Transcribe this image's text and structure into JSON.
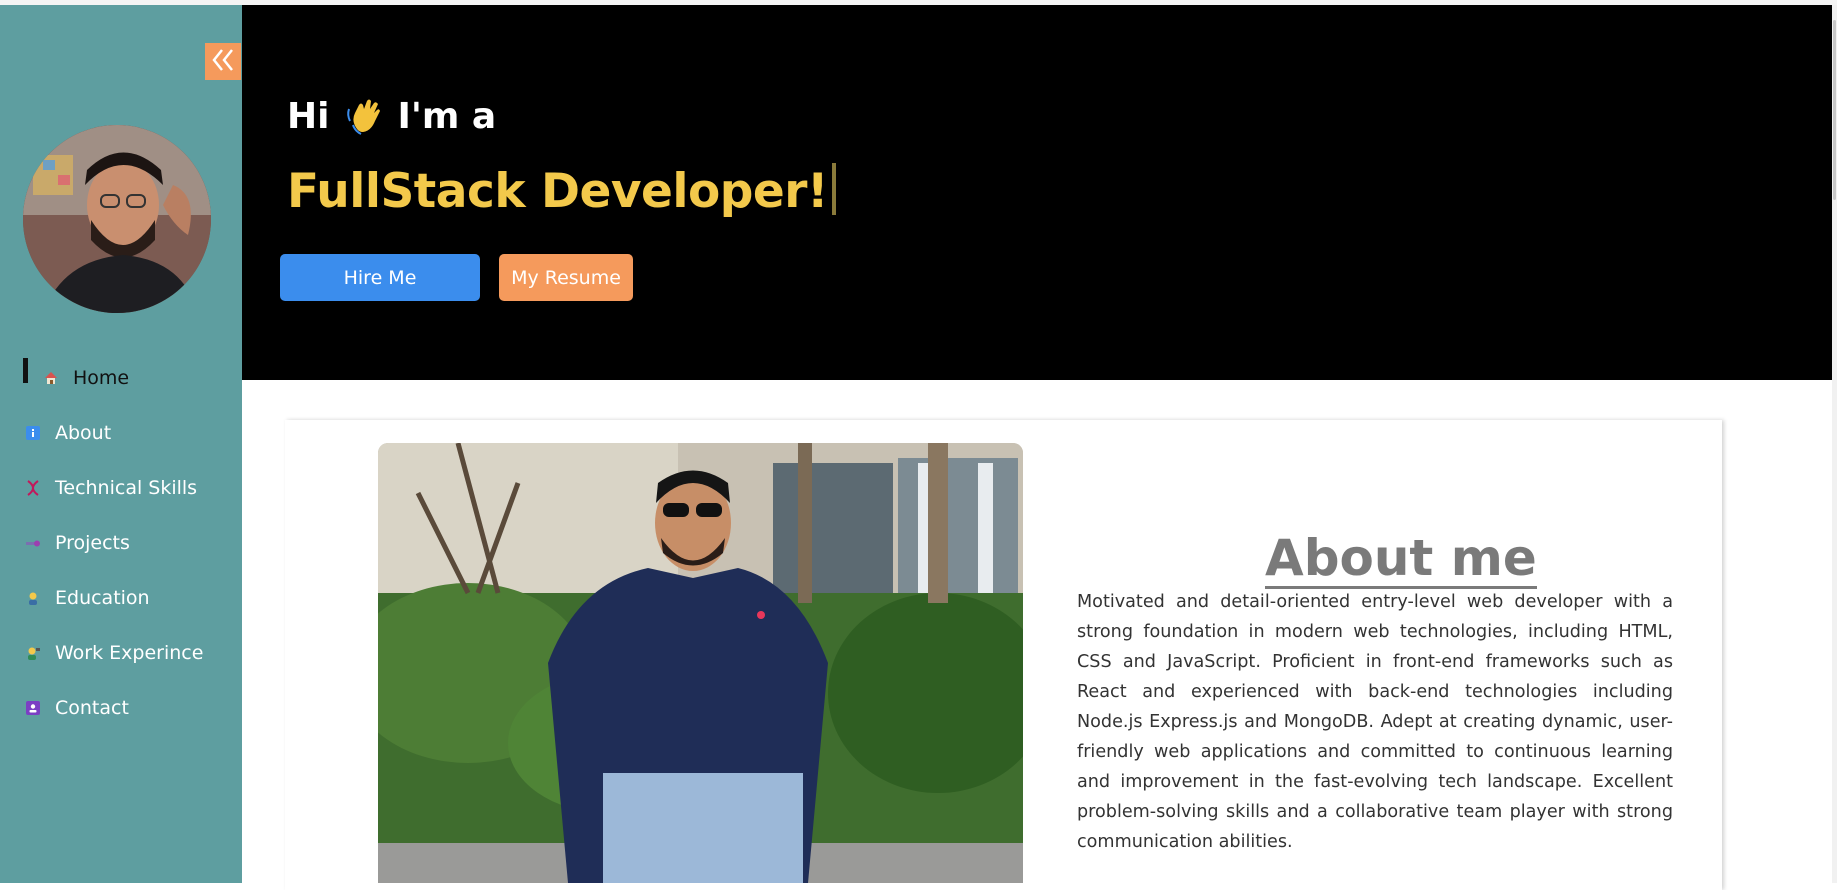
{
  "sidebar": {
    "nav": [
      {
        "label": "Home",
        "icon": "home-icon",
        "active": true
      },
      {
        "label": "About",
        "icon": "info-icon"
      },
      {
        "label": "Technical Skills",
        "icon": "dna-icon"
      },
      {
        "label": "Projects",
        "icon": "project-icon"
      },
      {
        "label": "Education",
        "icon": "student-icon"
      },
      {
        "label": "Work Experince",
        "icon": "worker-icon"
      },
      {
        "label": "Contact",
        "icon": "contact-icon"
      }
    ],
    "collapse_icon": "double-chevron-left-icon",
    "colors": {
      "background": "#5e9ea0",
      "collapse_button": "#f59a5c"
    }
  },
  "hero": {
    "greeting_before": "Hi",
    "greeting_after": "I'm a",
    "wave_icon": "waving-hand-icon",
    "role": "FullStack Developer!",
    "hire_label": "Hire Me",
    "resume_label": "My Resume",
    "colors": {
      "background": "#000000",
      "role": "#f3c94b",
      "hire": "#3b8ded",
      "resume": "#f59a5c"
    }
  },
  "about": {
    "title": "About me",
    "text": "Motivated and detail-oriented entry-level web developer with a strong foundation in modern web technologies, including HTML, CSS and JavaScript. Proficient in front-end frameworks such as React and experienced with back-end technologies including Node.js Express.js and MongoDB. Adept at creating dynamic, user-friendly web applications and committed to continuous learning and improvement in the fast-evolving tech landscape. Excellent problem-solving skills and a collaborative team player with strong communication abilities."
  }
}
